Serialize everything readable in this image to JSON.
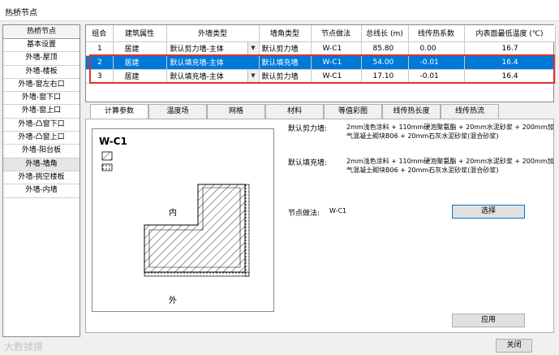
{
  "window": {
    "title": "热桥节点"
  },
  "sidebar": {
    "header": "热桥节点",
    "items": [
      "基本设置",
      "外墙-屋顶",
      "外墙-楼板",
      "外墙-窗左右口",
      "外墙-窗下口",
      "外墙-窗上口",
      "外墙-凸窗下口",
      "外墙-凸窗上口",
      "外墙-阳台板",
      "外墙-墙角",
      "外墙-挑空楼板",
      "外墙-内墙"
    ],
    "selected_index": 9
  },
  "grid": {
    "columns": [
      "组合",
      "建筑属性",
      "外墙类型",
      "墙角类型",
      "节点做法",
      "总线长 (m)",
      "线传热系数",
      "内表面最低温度 (℃)"
    ],
    "rows": [
      [
        "1",
        "居建",
        "默认剪力墙-主体",
        "默认剪力墙",
        "W-C1",
        "85.80",
        "0.00",
        "16.7"
      ],
      [
        "2",
        "居建",
        "默认填充墙-主体",
        "默认填充墙",
        "W-C1",
        "54.00",
        "-0.01",
        "16.4"
      ],
      [
        "3",
        "居建",
        "默认填充墙-主体",
        "默认剪力墙",
        "W-C1",
        "17.10",
        "-0.01",
        "16.4"
      ]
    ],
    "selected_row": 1
  },
  "tabs": [
    "计算参数",
    "温度场",
    "网格",
    "材料",
    "等值彩图",
    "线传热长度",
    "线传热流"
  ],
  "active_tab": 0,
  "diagram": {
    "title": "W-C1",
    "inside_label": "内",
    "outside_label": "外"
  },
  "params": {
    "line1_label": "默认剪力墙:",
    "line1_value_a": "2mm浅色涂料 + 110mm硬泡聚氨酯 + 20mm水泥砂浆 + 200mm加",
    "line1_value_b": "气混凝土砌块B06 + 20mm石灰水泥砂浆(混合砂浆)",
    "line2_label": "默认填充墙:",
    "line2_value_a": "2mm浅色涂料 + 110mm硬泡聚氨酯 + 20mm水泥砂浆 + 200mm加",
    "line2_value_b": "气混凝土砌块B06 + 20mm石灰水泥砂浆(混合砂浆)",
    "node_label": "节点做法:",
    "node_value": "W-C1"
  },
  "buttons": {
    "select": "选择",
    "apply": "应用",
    "close": "关闭"
  },
  "watermark": "大數據摸",
  "colors": {
    "selection": "#0078d7",
    "highlight_border": "#e0302a"
  }
}
